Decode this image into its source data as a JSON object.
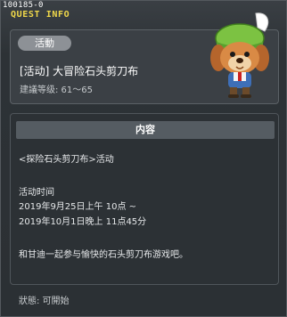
{
  "window": {
    "quest_id": "100185-0",
    "title": "QUEST INFO"
  },
  "summary": {
    "category": "活動",
    "name": "[活动] 大冒险石头剪刀布",
    "level_range": "建議等级: 61～65",
    "npc": "npc-portrait-icon"
  },
  "content": {
    "header": "内容",
    "lines": [
      "<探险石头剪刀布>活动",
      "活动时间",
      "2019年9月25日上午 10点 ~",
      "2019年10月1日晚上 11点45分",
      "和甘迪一起参与愉快的石头剪刀布游戏吧。"
    ]
  },
  "status": "狀態: 可開始"
}
